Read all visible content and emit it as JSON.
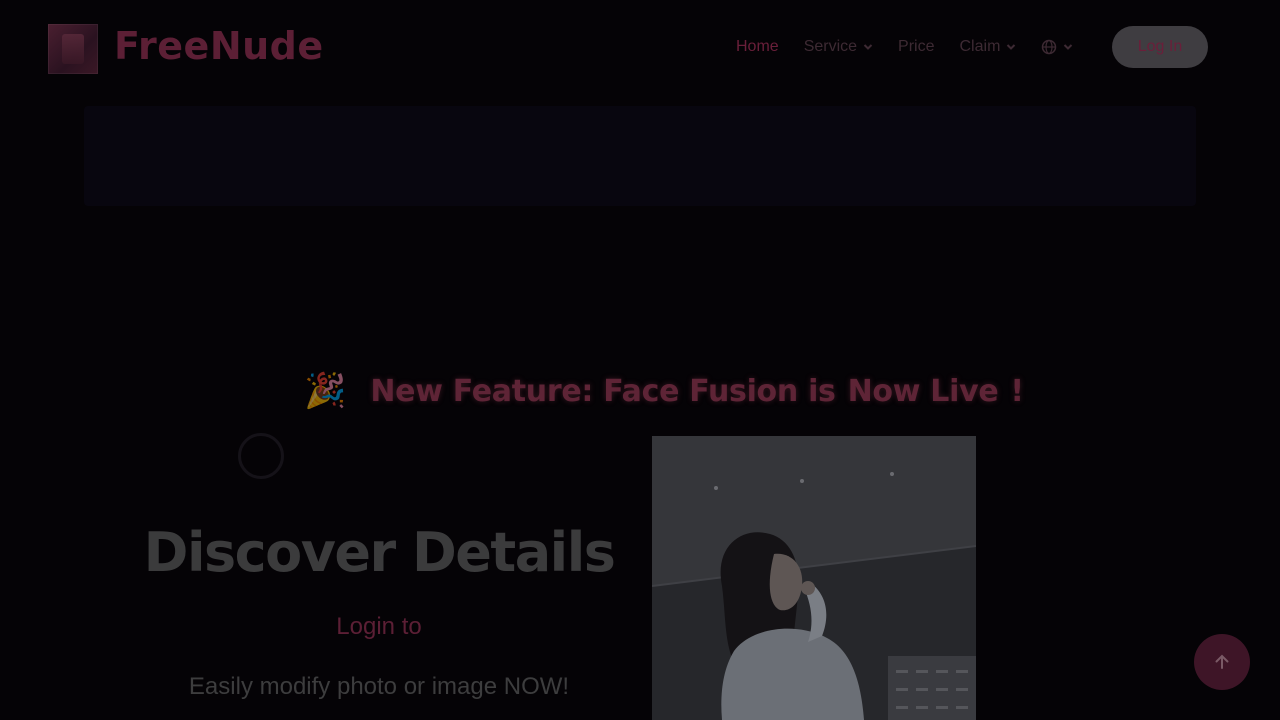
{
  "header": {
    "brand": "FreeNude",
    "logo_icon": "brand-logo-icon",
    "nav": {
      "home": "Home",
      "service": "Service",
      "price": "Price",
      "claim": "Claim"
    },
    "language_icon": "globe-icon",
    "login_label": "Log In"
  },
  "announcement": {
    "emoji": "🎉",
    "text_a": "New Feature: Face Fusion is",
    "text_b": "Now Live",
    "text_c": "!"
  },
  "hero": {
    "title": "Discover Details",
    "login_link": "Login to",
    "subtitle": "Easily modify photo or image NOW!"
  },
  "colors": {
    "brand": "#5c1f35",
    "background": "#050306"
  },
  "scroll_top_icon": "arrow-up-icon"
}
